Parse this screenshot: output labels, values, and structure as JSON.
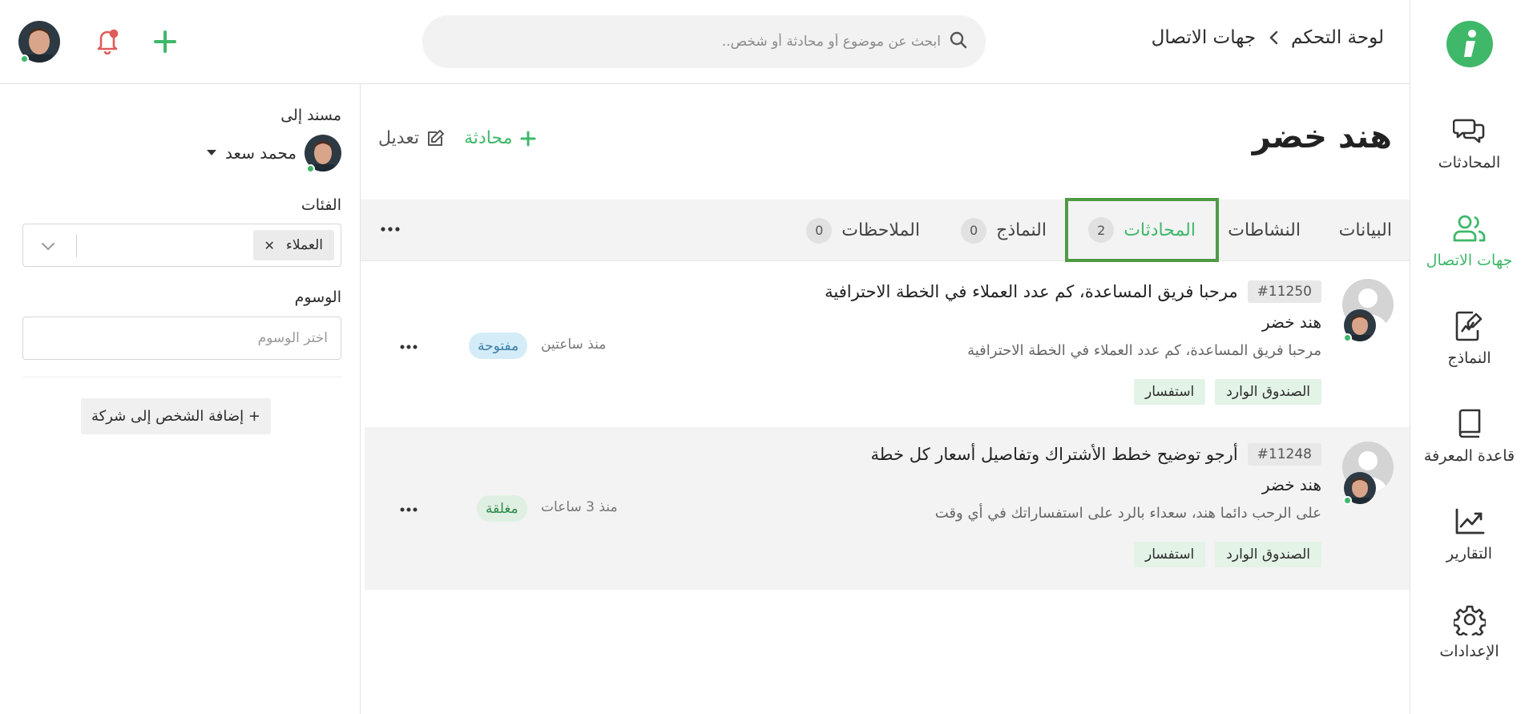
{
  "nav": {
    "items": [
      {
        "id": "conversations",
        "label": "المحادثات",
        "icon": "chat-bubbles-icon",
        "active": false
      },
      {
        "id": "contacts",
        "label": "جهات الاتصال",
        "icon": "contacts-icon",
        "active": true
      },
      {
        "id": "forms",
        "label": "النماذج",
        "icon": "forms-icon",
        "active": false
      },
      {
        "id": "knowledge",
        "label": "قاعدة المعرفة",
        "icon": "book-icon",
        "active": false
      },
      {
        "id": "reports",
        "label": "التقارير",
        "icon": "chart-icon",
        "active": false
      },
      {
        "id": "settings",
        "label": "الإعدادات",
        "icon": "gear-icon",
        "active": false
      }
    ]
  },
  "topbar": {
    "breadcrumb": [
      "لوحة التحكم",
      "جهات الاتصال"
    ],
    "search_placeholder": "ابحث عن موضوع أو محادثة أو شخص.."
  },
  "contact": {
    "name": "هند خضر",
    "actions": {
      "new_conversation": "محادثة",
      "edit": "تعديل"
    }
  },
  "tabs": [
    {
      "label": "البيانات",
      "count": null,
      "active": false
    },
    {
      "label": "النشاطات",
      "count": null,
      "active": false
    },
    {
      "label": "المحادثات",
      "count": "2",
      "active": true
    },
    {
      "label": "النماذج",
      "count": "0",
      "active": false
    },
    {
      "label": "الملاحظات",
      "count": "0",
      "active": false
    }
  ],
  "conversations": [
    {
      "id": "#11250",
      "subject": "مرحبا فريق المساعدة، كم عدد العملاء في الخطة الاحترافية",
      "sender": "هند خضر",
      "preview": "مرحبا فريق المساعدة، كم عدد العملاء في الخطة الاحترافية",
      "labels": [
        "الصندوق الوارد",
        "استفسار"
      ],
      "time": "منذ ساعتين",
      "status": "مفتوحة",
      "status_kind": "open"
    },
    {
      "id": "#11248",
      "subject": "أرجو توضيح خطط الأشتراك وتفاصيل أسعار كل خطة",
      "sender": "هند خضر",
      "preview": "على الرحب دائما هند، سعداء بالرد على استفساراتك في أي وقت",
      "labels": [
        "الصندوق الوارد",
        "استفسار"
      ],
      "time": "منذ 3 ساعات",
      "status": "مغلقة",
      "status_kind": "closed"
    }
  ],
  "sidebar": {
    "assigned_label": "مسند إلى",
    "assignee_name": "محمد سعد",
    "categories_label": "الفئات",
    "category_chip": "العملاء",
    "tags_label": "الوسوم",
    "tags_placeholder": "اختر الوسوم",
    "add_company": "+ إضافة الشخص إلى شركة"
  },
  "colors": {
    "accent": "#3fb86a",
    "active_tab_border": "#4f9a45",
    "bell": "#e05a5a",
    "status_open_bg": "#d4ecf7",
    "status_closed_bg": "#dff0e3"
  }
}
